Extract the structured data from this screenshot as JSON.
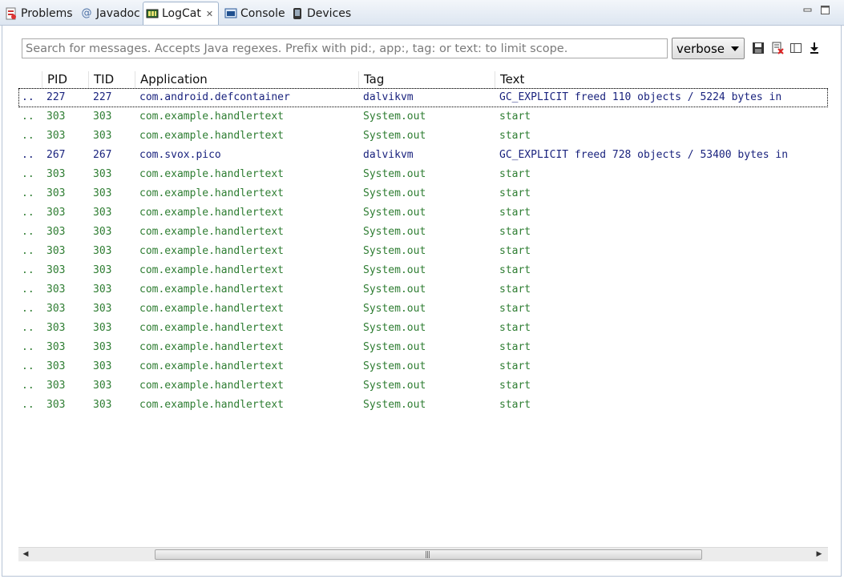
{
  "tabs": [
    {
      "label": "Problems",
      "icon": "problems-icon"
    },
    {
      "label": "Javadoc",
      "icon": "at-icon"
    },
    {
      "label": "LogCat",
      "icon": "logcat-icon",
      "active": true
    },
    {
      "label": "Console",
      "icon": "console-icon"
    },
    {
      "label": "Devices",
      "icon": "device-icon"
    }
  ],
  "search": {
    "placeholder": "Search for messages. Accepts Java regexes. Prefix with pid:, app:, tag: or text: to limit scope."
  },
  "level": {
    "value": "verbose"
  },
  "toolbar": [
    "save-icon",
    "clear-log-icon",
    "toggle-pane-icon",
    "scroll-lock-icon"
  ],
  "columns": {
    "pid": "PID",
    "tid": "TID",
    "app": "Application",
    "tag": "Tag",
    "text": "Text"
  },
  "colors": {
    "debug": "#1a237e",
    "info": "#2e7d32"
  },
  "rows": [
    {
      "lvl": "..",
      "pid": "227",
      "tid": "227",
      "app": "com.android.defcontainer",
      "tag": "dalvikvm",
      "text": "GC_EXPLICIT freed 110 objects / 5224 bytes in",
      "level": "debug",
      "selected": true
    },
    {
      "lvl": "..",
      "pid": "303",
      "tid": "303",
      "app": "com.example.handlertext",
      "tag": "System.out",
      "text": "start",
      "level": "info"
    },
    {
      "lvl": "..",
      "pid": "303",
      "tid": "303",
      "app": "com.example.handlertext",
      "tag": "System.out",
      "text": "start",
      "level": "info"
    },
    {
      "lvl": "..",
      "pid": "267",
      "tid": "267",
      "app": "com.svox.pico",
      "tag": "dalvikvm",
      "text": "GC_EXPLICIT freed 728 objects / 53400 bytes in",
      "level": "debug"
    },
    {
      "lvl": "..",
      "pid": "303",
      "tid": "303",
      "app": "com.example.handlertext",
      "tag": "System.out",
      "text": "start",
      "level": "info"
    },
    {
      "lvl": "..",
      "pid": "303",
      "tid": "303",
      "app": "com.example.handlertext",
      "tag": "System.out",
      "text": "start",
      "level": "info"
    },
    {
      "lvl": "..",
      "pid": "303",
      "tid": "303",
      "app": "com.example.handlertext",
      "tag": "System.out",
      "text": "start",
      "level": "info"
    },
    {
      "lvl": "..",
      "pid": "303",
      "tid": "303",
      "app": "com.example.handlertext",
      "tag": "System.out",
      "text": "start",
      "level": "info"
    },
    {
      "lvl": "..",
      "pid": "303",
      "tid": "303",
      "app": "com.example.handlertext",
      "tag": "System.out",
      "text": "start",
      "level": "info"
    },
    {
      "lvl": "..",
      "pid": "303",
      "tid": "303",
      "app": "com.example.handlertext",
      "tag": "System.out",
      "text": "start",
      "level": "info"
    },
    {
      "lvl": "..",
      "pid": "303",
      "tid": "303",
      "app": "com.example.handlertext",
      "tag": "System.out",
      "text": "start",
      "level": "info"
    },
    {
      "lvl": "..",
      "pid": "303",
      "tid": "303",
      "app": "com.example.handlertext",
      "tag": "System.out",
      "text": "start",
      "level": "info"
    },
    {
      "lvl": "..",
      "pid": "303",
      "tid": "303",
      "app": "com.example.handlertext",
      "tag": "System.out",
      "text": "start",
      "level": "info"
    },
    {
      "lvl": "..",
      "pid": "303",
      "tid": "303",
      "app": "com.example.handlertext",
      "tag": "System.out",
      "text": "start",
      "level": "info"
    },
    {
      "lvl": "..",
      "pid": "303",
      "tid": "303",
      "app": "com.example.handlertext",
      "tag": "System.out",
      "text": "start",
      "level": "info"
    },
    {
      "lvl": "..",
      "pid": "303",
      "tid": "303",
      "app": "com.example.handlertext",
      "tag": "System.out",
      "text": "start",
      "level": "info"
    },
    {
      "lvl": "..",
      "pid": "303",
      "tid": "303",
      "app": "com.example.handlertext",
      "tag": "System.out",
      "text": "start",
      "level": "info"
    }
  ]
}
